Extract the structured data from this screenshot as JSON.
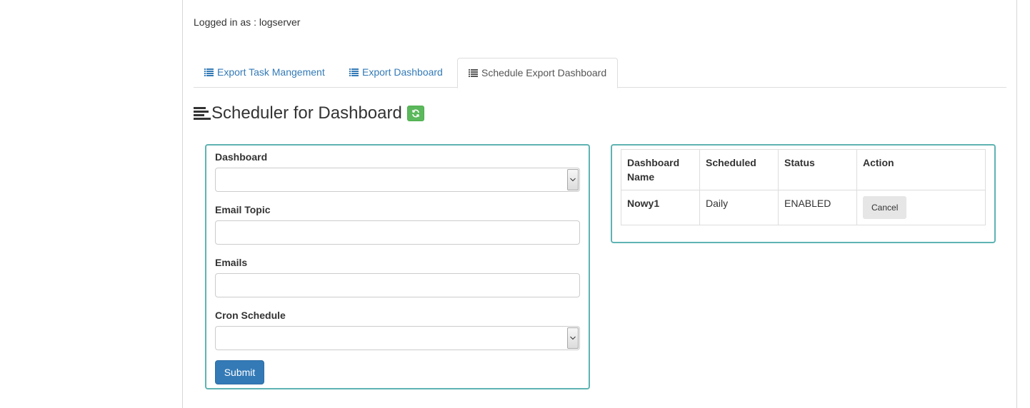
{
  "header": {
    "logged_in_text": "Logged in as : logserver"
  },
  "tabs": [
    {
      "label": "Export Task Mangement",
      "icon": "list-icon",
      "active": false
    },
    {
      "label": "Export Dashboard",
      "icon": "list-icon",
      "active": false
    },
    {
      "label": "Schedule Export Dashboard",
      "icon": "list-icon",
      "active": true
    }
  ],
  "page": {
    "title": "Scheduler for Dashboard",
    "title_icon": "align-left-icon",
    "refresh_icon": "refresh-icon"
  },
  "form": {
    "dashboard_label": "Dashboard",
    "dashboard_value": "",
    "email_topic_label": "Email Topic",
    "email_topic_value": "",
    "emails_label": "Emails",
    "emails_value": "",
    "cron_label": "Cron Schedule",
    "cron_value": "",
    "submit_label": "Submit"
  },
  "table": {
    "headers": [
      "Dashboard Name",
      "Scheduled",
      "Status",
      "Action"
    ],
    "rows": [
      {
        "name": "Nowy1",
        "scheduled": "Daily",
        "status": "ENABLED",
        "action": "Cancel"
      }
    ]
  },
  "colors": {
    "link": "#337ab7",
    "panel_border": "#5fb3b3",
    "refresh_button": "#5cb85c",
    "submit_button": "#337ab7"
  }
}
